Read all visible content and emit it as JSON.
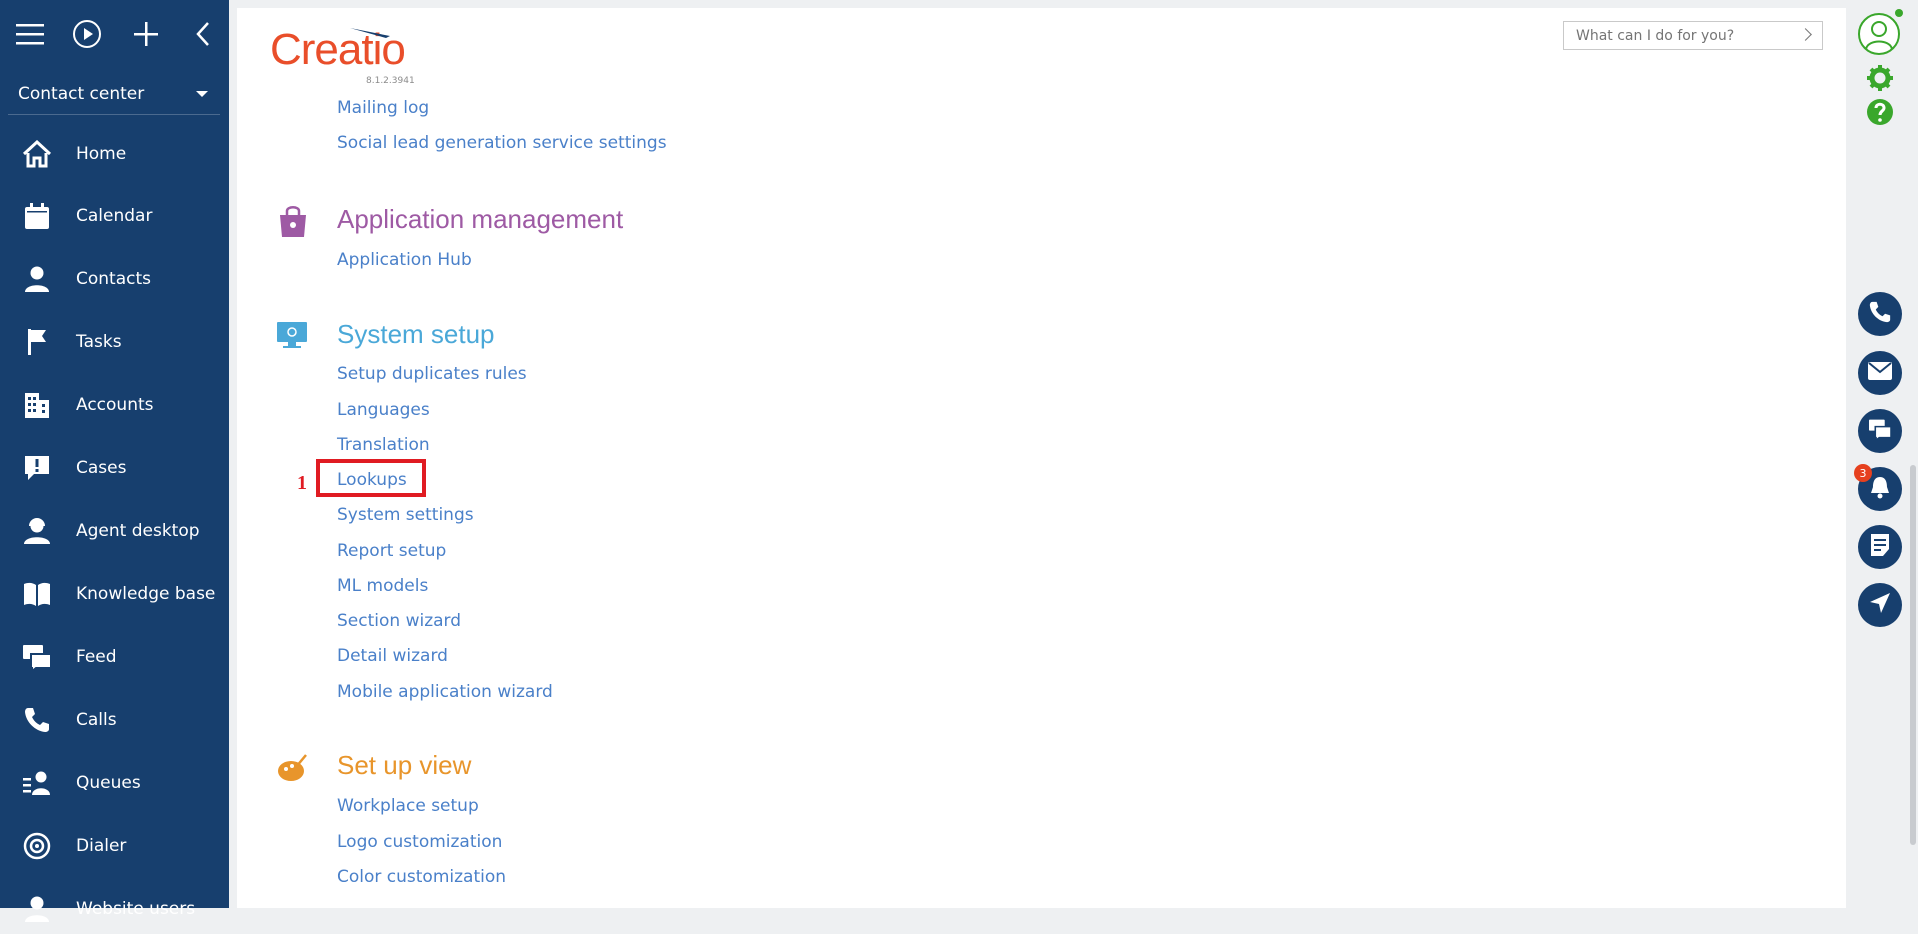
{
  "sidebar": {
    "workplace": "Contact center",
    "items": [
      {
        "label": "Home",
        "icon": "home-icon"
      },
      {
        "label": "Calendar",
        "icon": "calendar-icon"
      },
      {
        "label": "Contacts",
        "icon": "contact-icon"
      },
      {
        "label": "Tasks",
        "icon": "flag-icon"
      },
      {
        "label": "Accounts",
        "icon": "building-icon"
      },
      {
        "label": "Cases",
        "icon": "case-alert-icon"
      },
      {
        "label": "Agent desktop",
        "icon": "agent-icon"
      },
      {
        "label": "Knowledge base",
        "icon": "book-icon"
      },
      {
        "label": "Feed",
        "icon": "chat-icon"
      },
      {
        "label": "Calls",
        "icon": "phone-icon"
      },
      {
        "label": "Queues",
        "icon": "queue-icon"
      },
      {
        "label": "Dialer",
        "icon": "dialer-icon"
      },
      {
        "label": "Website users",
        "icon": "user-icon"
      }
    ]
  },
  "header": {
    "logo_text": "Creatio",
    "version": "8.1.2.3941",
    "search_placeholder": "What can I do for you?"
  },
  "content": {
    "partial_links": [
      {
        "label": "Mailing log"
      },
      {
        "label": "Social lead generation service settings"
      }
    ],
    "sections": [
      {
        "title": "Application management",
        "color": "#9e5aa4",
        "links": [
          "Application Hub"
        ]
      },
      {
        "title": "System setup",
        "color": "#4aa8d8",
        "links": [
          "Setup duplicates rules",
          "Languages",
          "Translation",
          "Lookups",
          "System settings",
          "Report setup",
          "ML models",
          "Section wizard",
          "Detail wizard",
          "Mobile application wizard"
        ]
      },
      {
        "title": "Set up view",
        "color": "#e8952b",
        "links": [
          "Workplace setup",
          "Logo customization",
          "Color customization"
        ]
      }
    ]
  },
  "annotation": {
    "step": "1"
  },
  "rightbar": {
    "notification_count": "3"
  },
  "colors": {
    "sidebar": "#173f6e",
    "link": "#4a80c9",
    "highlight": "#e01b22",
    "accent_green": "#3aa72c"
  }
}
